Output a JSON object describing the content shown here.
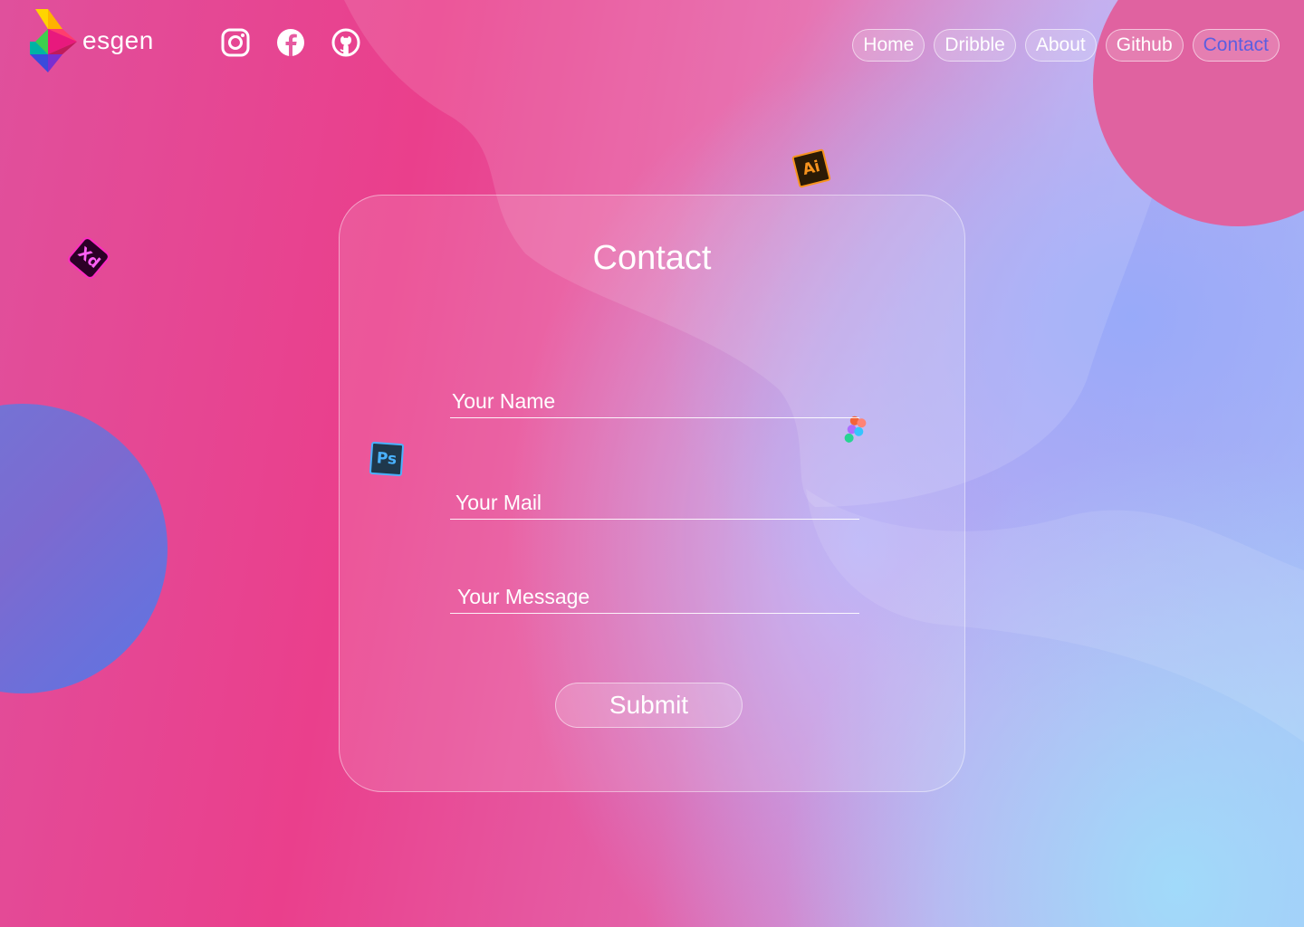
{
  "brand": {
    "logo_text": "esgen"
  },
  "socials": [
    {
      "icon": "instagram-icon"
    },
    {
      "icon": "facebook-icon"
    },
    {
      "icon": "github-icon"
    }
  ],
  "nav": {
    "items": [
      {
        "label": "Home"
      },
      {
        "label": "Dribble"
      },
      {
        "label": "About"
      },
      {
        "label": "Github"
      },
      {
        "label": "Contact",
        "active": true
      }
    ],
    "active_color": "#5b5fe0"
  },
  "tools": {
    "ai": "Ai",
    "xd": "Xd",
    "ps": "Ps"
  },
  "contact": {
    "title": "Contact",
    "name_placeholder": "Your Name",
    "mail_placeholder": "Your Mail",
    "message_placeholder": "Your Message",
    "submit_label": "Submit"
  },
  "colors": {
    "pink": "#ea3f8c",
    "lavender": "#b8b0f7",
    "light_blue": "#a8d8f8"
  }
}
